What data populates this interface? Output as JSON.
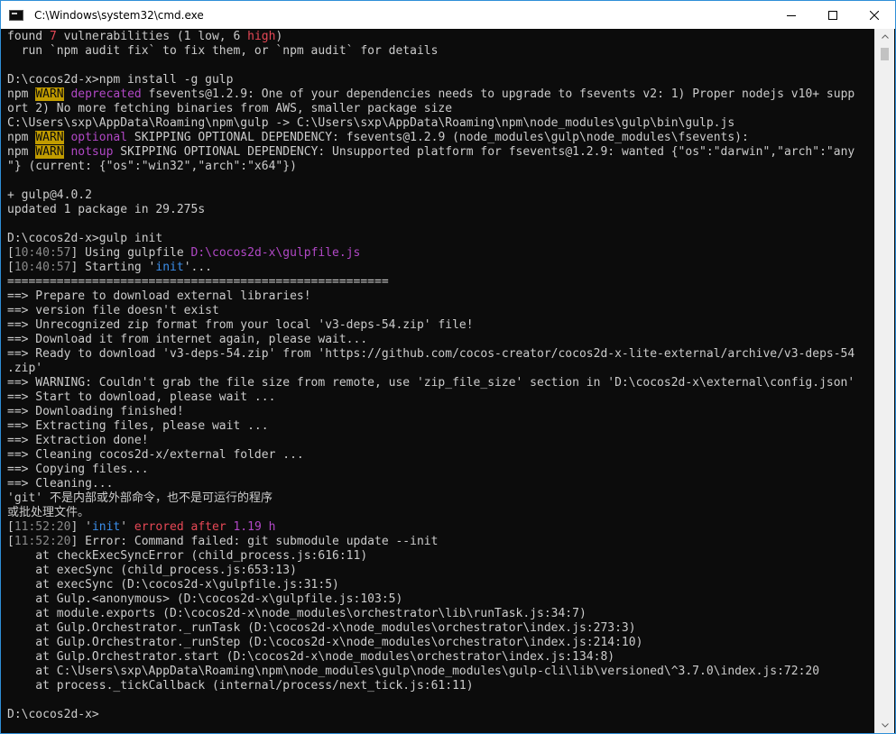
{
  "window": {
    "title": "C:\\Windows\\system32\\cmd.exe",
    "accent": "#2f8fd8"
  },
  "icons": {
    "app": "cmd-icon",
    "minimize": "minimize-icon",
    "maximize": "maximize-icon",
    "close": "close-icon",
    "scroll_up": "chevron-up-icon",
    "scroll_down": "chevron-down-icon"
  },
  "colors": {
    "background": "#0c0c0c",
    "text": "#cccccc",
    "red": "#e74856",
    "magenta": "#b148c6",
    "blue": "#3b8eea",
    "warn_badge": "#c19c00"
  },
  "console": {
    "lines": [
      [
        {
          "t": "found "
        },
        {
          "t": "7",
          "c": "red"
        },
        {
          "t": " vulnerabilities (1 low, 6 "
        },
        {
          "t": "high",
          "c": "red"
        },
        {
          "t": ")"
        }
      ],
      [
        {
          "t": "  run `npm audit fix` to fix them, or `npm audit` for details"
        }
      ],
      [],
      [
        {
          "t": "D:\\cocos2d-x>npm install -g gulp"
        }
      ],
      [
        {
          "t": "npm "
        },
        {
          "t": "WARN",
          "c": "warn"
        },
        {
          "t": " "
        },
        {
          "t": "deprecated",
          "c": "magenta"
        },
        {
          "t": " fsevents@1.2.9: One of your dependencies needs to upgrade to fsevents v2: 1) Proper nodejs v10+ supp"
        }
      ],
      [
        {
          "t": "ort 2) No more fetching binaries from AWS, smaller package size"
        }
      ],
      [
        {
          "t": "C:\\Users\\sxp\\AppData\\Roaming\\npm\\gulp -> C:\\Users\\sxp\\AppData\\Roaming\\npm\\node_modules\\gulp\\bin\\gulp.js"
        }
      ],
      [
        {
          "t": "npm "
        },
        {
          "t": "WARN",
          "c": "warn"
        },
        {
          "t": " "
        },
        {
          "t": "optional",
          "c": "magenta"
        },
        {
          "t": " SKIPPING OPTIONAL DEPENDENCY: fsevents@1.2.9 (node_modules\\gulp\\node_modules\\fsevents):"
        }
      ],
      [
        {
          "t": "npm "
        },
        {
          "t": "WARN",
          "c": "warn"
        },
        {
          "t": " "
        },
        {
          "t": "notsup",
          "c": "magenta"
        },
        {
          "t": " SKIPPING OPTIONAL DEPENDENCY: Unsupported platform for fsevents@1.2.9: wanted {\"os\":\"darwin\",\"arch\":\"any"
        }
      ],
      [
        {
          "t": "\"} (current: {\"os\":\"win32\",\"arch\":\"x64\"})"
        }
      ],
      [],
      [
        {
          "t": "+ gulp@4.0.2"
        }
      ],
      [
        {
          "t": "updated 1 package in 29.275s"
        }
      ],
      [],
      [
        {
          "t": "D:\\cocos2d-x>gulp init"
        }
      ],
      [
        {
          "t": "["
        },
        {
          "t": "10:40:57",
          "c": "grey"
        },
        {
          "t": "] Using gulpfile "
        },
        {
          "t": "D:\\cocos2d-x\\gulpfile.js",
          "c": "magenta"
        }
      ],
      [
        {
          "t": "["
        },
        {
          "t": "10:40:57",
          "c": "grey"
        },
        {
          "t": "] Starting '"
        },
        {
          "t": "init",
          "c": "blue"
        },
        {
          "t": "'..."
        }
      ],
      [
        {
          "t": "======================================================"
        }
      ],
      [
        {
          "t": "==> Prepare to download external libraries!"
        }
      ],
      [
        {
          "t": "==> version file doesn't exist"
        }
      ],
      [
        {
          "t": "==> Unrecognized zip format from your local 'v3-deps-54.zip' file!"
        }
      ],
      [
        {
          "t": "==> Download it from internet again, please wait..."
        }
      ],
      [
        {
          "t": "==> Ready to download 'v3-deps-54.zip' from 'https://github.com/cocos-creator/cocos2d-x-lite-external/archive/v3-deps-54"
        }
      ],
      [
        {
          "t": ".zip'"
        }
      ],
      [
        {
          "t": "==> WARNING: Couldn't grab the file size from remote, use 'zip_file_size' section in 'D:\\cocos2d-x\\external\\config.json'"
        }
      ],
      [
        {
          "t": "==> Start to download, please wait ..."
        }
      ],
      [
        {
          "t": "==> Downloading finished!"
        }
      ],
      [
        {
          "t": "==> Extracting files, please wait ..."
        }
      ],
      [
        {
          "t": "==> Extraction done!"
        }
      ],
      [
        {
          "t": "==> Cleaning cocos2d-x/external folder ..."
        }
      ],
      [
        {
          "t": "==> Copying files..."
        }
      ],
      [
        {
          "t": "==> Cleaning..."
        }
      ],
      [
        {
          "t": "'git' 不是内部或外部命令，也不是可运行的程序"
        }
      ],
      [
        {
          "t": "或批处理文件。"
        }
      ],
      [
        {
          "t": "["
        },
        {
          "t": "11:52:20",
          "c": "grey"
        },
        {
          "t": "] '"
        },
        {
          "t": "init",
          "c": "blue"
        },
        {
          "t": "' "
        },
        {
          "t": "errored after",
          "c": "red"
        },
        {
          "t": " "
        },
        {
          "t": "1.19 h",
          "c": "magenta"
        }
      ],
      [
        {
          "t": "["
        },
        {
          "t": "11:52:20",
          "c": "grey"
        },
        {
          "t": "] Error: Command failed: git submodule update --init"
        }
      ],
      [
        {
          "t": "    at checkExecSyncError (child_process.js:616:11)"
        }
      ],
      [
        {
          "t": "    at execSync (child_process.js:653:13)"
        }
      ],
      [
        {
          "t": "    at execSync (D:\\cocos2d-x\\gulpfile.js:31:5)"
        }
      ],
      [
        {
          "t": "    at Gulp.<anonymous> (D:\\cocos2d-x\\gulpfile.js:103:5)"
        }
      ],
      [
        {
          "t": "    at module.exports (D:\\cocos2d-x\\node_modules\\orchestrator\\lib\\runTask.js:34:7)"
        }
      ],
      [
        {
          "t": "    at Gulp.Orchestrator._runTask (D:\\cocos2d-x\\node_modules\\orchestrator\\index.js:273:3)"
        }
      ],
      [
        {
          "t": "    at Gulp.Orchestrator._runStep (D:\\cocos2d-x\\node_modules\\orchestrator\\index.js:214:10)"
        }
      ],
      [
        {
          "t": "    at Gulp.Orchestrator.start (D:\\cocos2d-x\\node_modules\\orchestrator\\index.js:134:8)"
        }
      ],
      [
        {
          "t": "    at C:\\Users\\sxp\\AppData\\Roaming\\npm\\node_modules\\gulp\\node_modules\\gulp-cli\\lib\\versioned\\^3.7.0\\index.js:72:20"
        }
      ],
      [
        {
          "t": "    at process._tickCallback (internal/process/next_tick.js:61:11)"
        }
      ],
      [],
      [
        {
          "t": "D:\\cocos2d-x>"
        }
      ]
    ]
  }
}
